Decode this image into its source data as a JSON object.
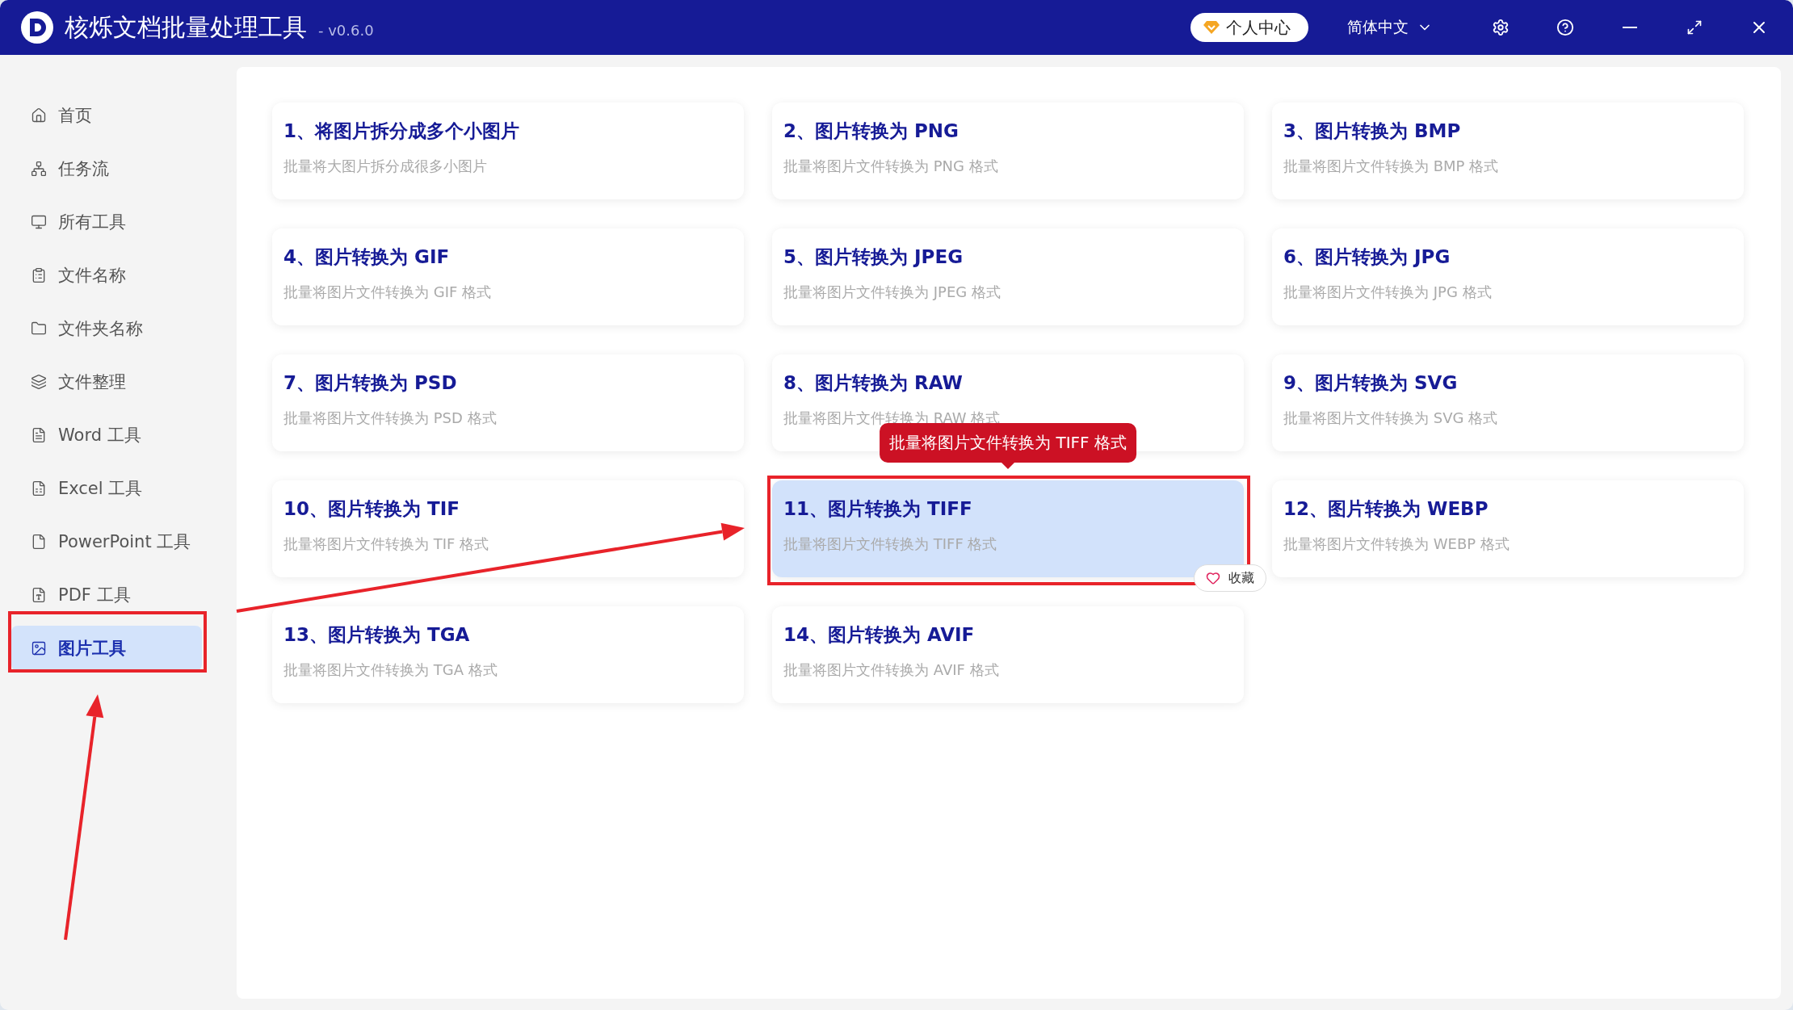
{
  "window": {
    "title": "核烁文档批量处理工具",
    "version": "- v0.6.0",
    "account_button": "个人中心",
    "language": "简体中文"
  },
  "sidebar": {
    "items": [
      {
        "label": "首页",
        "selected": false
      },
      {
        "label": "任务流",
        "selected": false
      },
      {
        "label": "所有工具",
        "selected": false
      },
      {
        "label": "文件名称",
        "selected": false
      },
      {
        "label": "文件夹名称",
        "selected": false
      },
      {
        "label": "文件整理",
        "selected": false
      },
      {
        "label": "Word 工具",
        "selected": false
      },
      {
        "label": "Excel 工具",
        "selected": false
      },
      {
        "label": "PowerPoint 工具",
        "selected": false
      },
      {
        "label": "PDF 工具",
        "selected": false
      },
      {
        "label": "图片工具",
        "selected": true
      }
    ]
  },
  "tools": [
    {
      "title": "1、将图片拆分成多个小图片",
      "description": "批量将大图片拆分成很多小图片",
      "hovered": false
    },
    {
      "title": "2、图片转换为 PNG",
      "description": "批量将图片文件转换为 PNG 格式",
      "hovered": false
    },
    {
      "title": "3、图片转换为 BMP",
      "description": "批量将图片文件转换为 BMP 格式",
      "hovered": false
    },
    {
      "title": "4、图片转换为 GIF",
      "description": "批量将图片文件转换为 GIF 格式",
      "hovered": false
    },
    {
      "title": "5、图片转换为 JPEG",
      "description": "批量将图片文件转换为 JPEG 格式",
      "hovered": false
    },
    {
      "title": "6、图片转换为 JPG",
      "description": "批量将图片文件转换为 JPG 格式",
      "hovered": false
    },
    {
      "title": "7、图片转换为 PSD",
      "description": "批量将图片文件转换为 PSD 格式",
      "hovered": false
    },
    {
      "title": "8、图片转换为 RAW",
      "description": "批量将图片文件转换为 RAW 格式",
      "hovered": false
    },
    {
      "title": "9、图片转换为 SVG",
      "description": "批量将图片文件转换为 SVG 格式",
      "hovered": false
    },
    {
      "title": "10、图片转换为 TIF",
      "description": "批量将图片文件转换为 TIF 格式",
      "hovered": false
    },
    {
      "title": "11、图片转换为 TIFF",
      "description": "批量将图片文件转换为 TIFF 格式",
      "hovered": true,
      "favorite_label": "收藏"
    },
    {
      "title": "12、图片转换为 WEBP",
      "description": "批量将图片文件转换为 WEBP 格式",
      "hovered": false
    },
    {
      "title": "13、图片转换为 TGA",
      "description": "批量将图片文件转换为 TGA 格式",
      "hovered": false
    },
    {
      "title": "14、图片转换为 AVIF",
      "description": "批量将图片文件转换为 AVIF 格式",
      "hovered": false
    }
  ],
  "tooltip": {
    "text": "批量将图片文件转换为 TIFF 格式"
  }
}
